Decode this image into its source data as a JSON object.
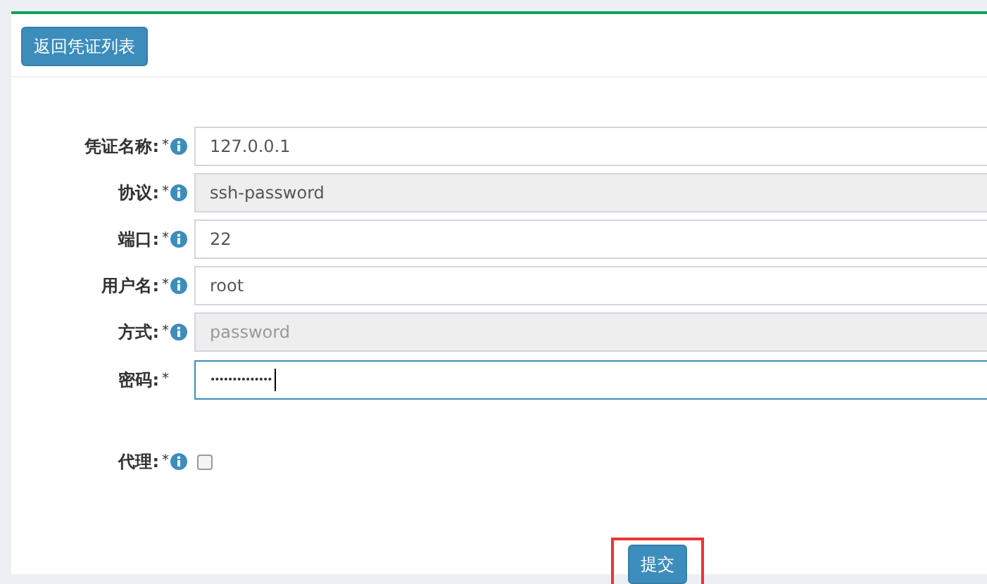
{
  "back_button": {
    "label": "返回凭证列表"
  },
  "fields": [
    {
      "kind": "text",
      "label": "凭证名称:",
      "required": "*",
      "info": true,
      "value": "127.0.0.1",
      "disabled": false,
      "focused": false
    },
    {
      "kind": "text",
      "label": "协议:",
      "required": "*",
      "info": true,
      "value": "ssh-password",
      "disabled": true,
      "focused": false
    },
    {
      "kind": "text",
      "label": "端口:",
      "required": "*",
      "info": true,
      "value": "22",
      "disabled": false,
      "focused": false
    },
    {
      "kind": "text",
      "label": "用户名:",
      "required": "*",
      "info": true,
      "value": "root",
      "disabled": false,
      "focused": false
    },
    {
      "kind": "text",
      "label": "方式:",
      "required": "*",
      "info": true,
      "placeholder": "password",
      "disabled": true,
      "focused": false
    },
    {
      "kind": "password",
      "label": "密码:",
      "required": "*",
      "info": false,
      "value": "••••••••••••••",
      "focused": true
    },
    {
      "kind": "checkbox",
      "label": "代理:",
      "required": "*",
      "info": true,
      "checked": false
    }
  ],
  "submit_button": {
    "label": "提交",
    "highlighted": true
  }
}
